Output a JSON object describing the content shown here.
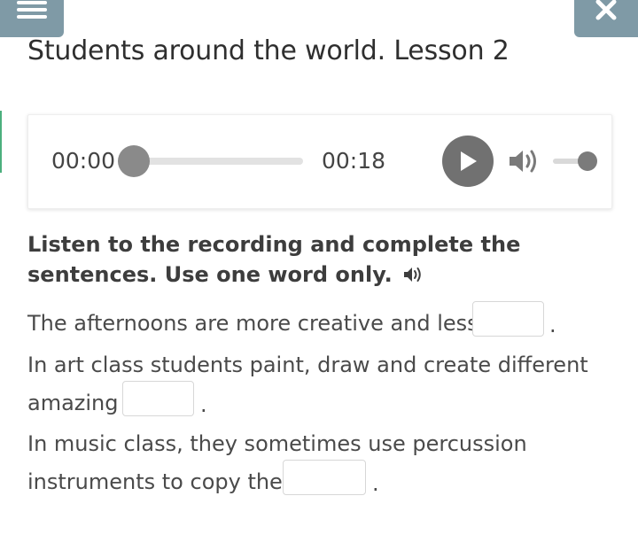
{
  "header": {
    "menu_icon": "hamburger-menu-icon",
    "close_icon": "close-icon",
    "title": "Students around the world. Lesson 2"
  },
  "player": {
    "current_time": "00:00",
    "total_time": "00:18",
    "progress": 0,
    "volume": 1,
    "play_icon": "play-icon",
    "volume_icon": "volume-icon"
  },
  "exercise": {
    "instruction": "Listen to the recording and complete the sentences. Use one word only.",
    "instruction_icon": "speaker-icon",
    "sentences": [
      {
        "line1": "The afternoons are more creative and less",
        "answer": "",
        "end": "."
      },
      {
        "line1": "In art class students paint, draw and create different",
        "line2": "amazing",
        "answer": "",
        "end": "."
      },
      {
        "line1": "In music class, they sometimes use percussion",
        "line2": "instruments to copy the",
        "answer": "",
        "end": "."
      }
    ]
  },
  "colors": {
    "header_button_bg": "#7f9aa6",
    "accent_green": "#4caf7d",
    "play_button": "#717171"
  }
}
